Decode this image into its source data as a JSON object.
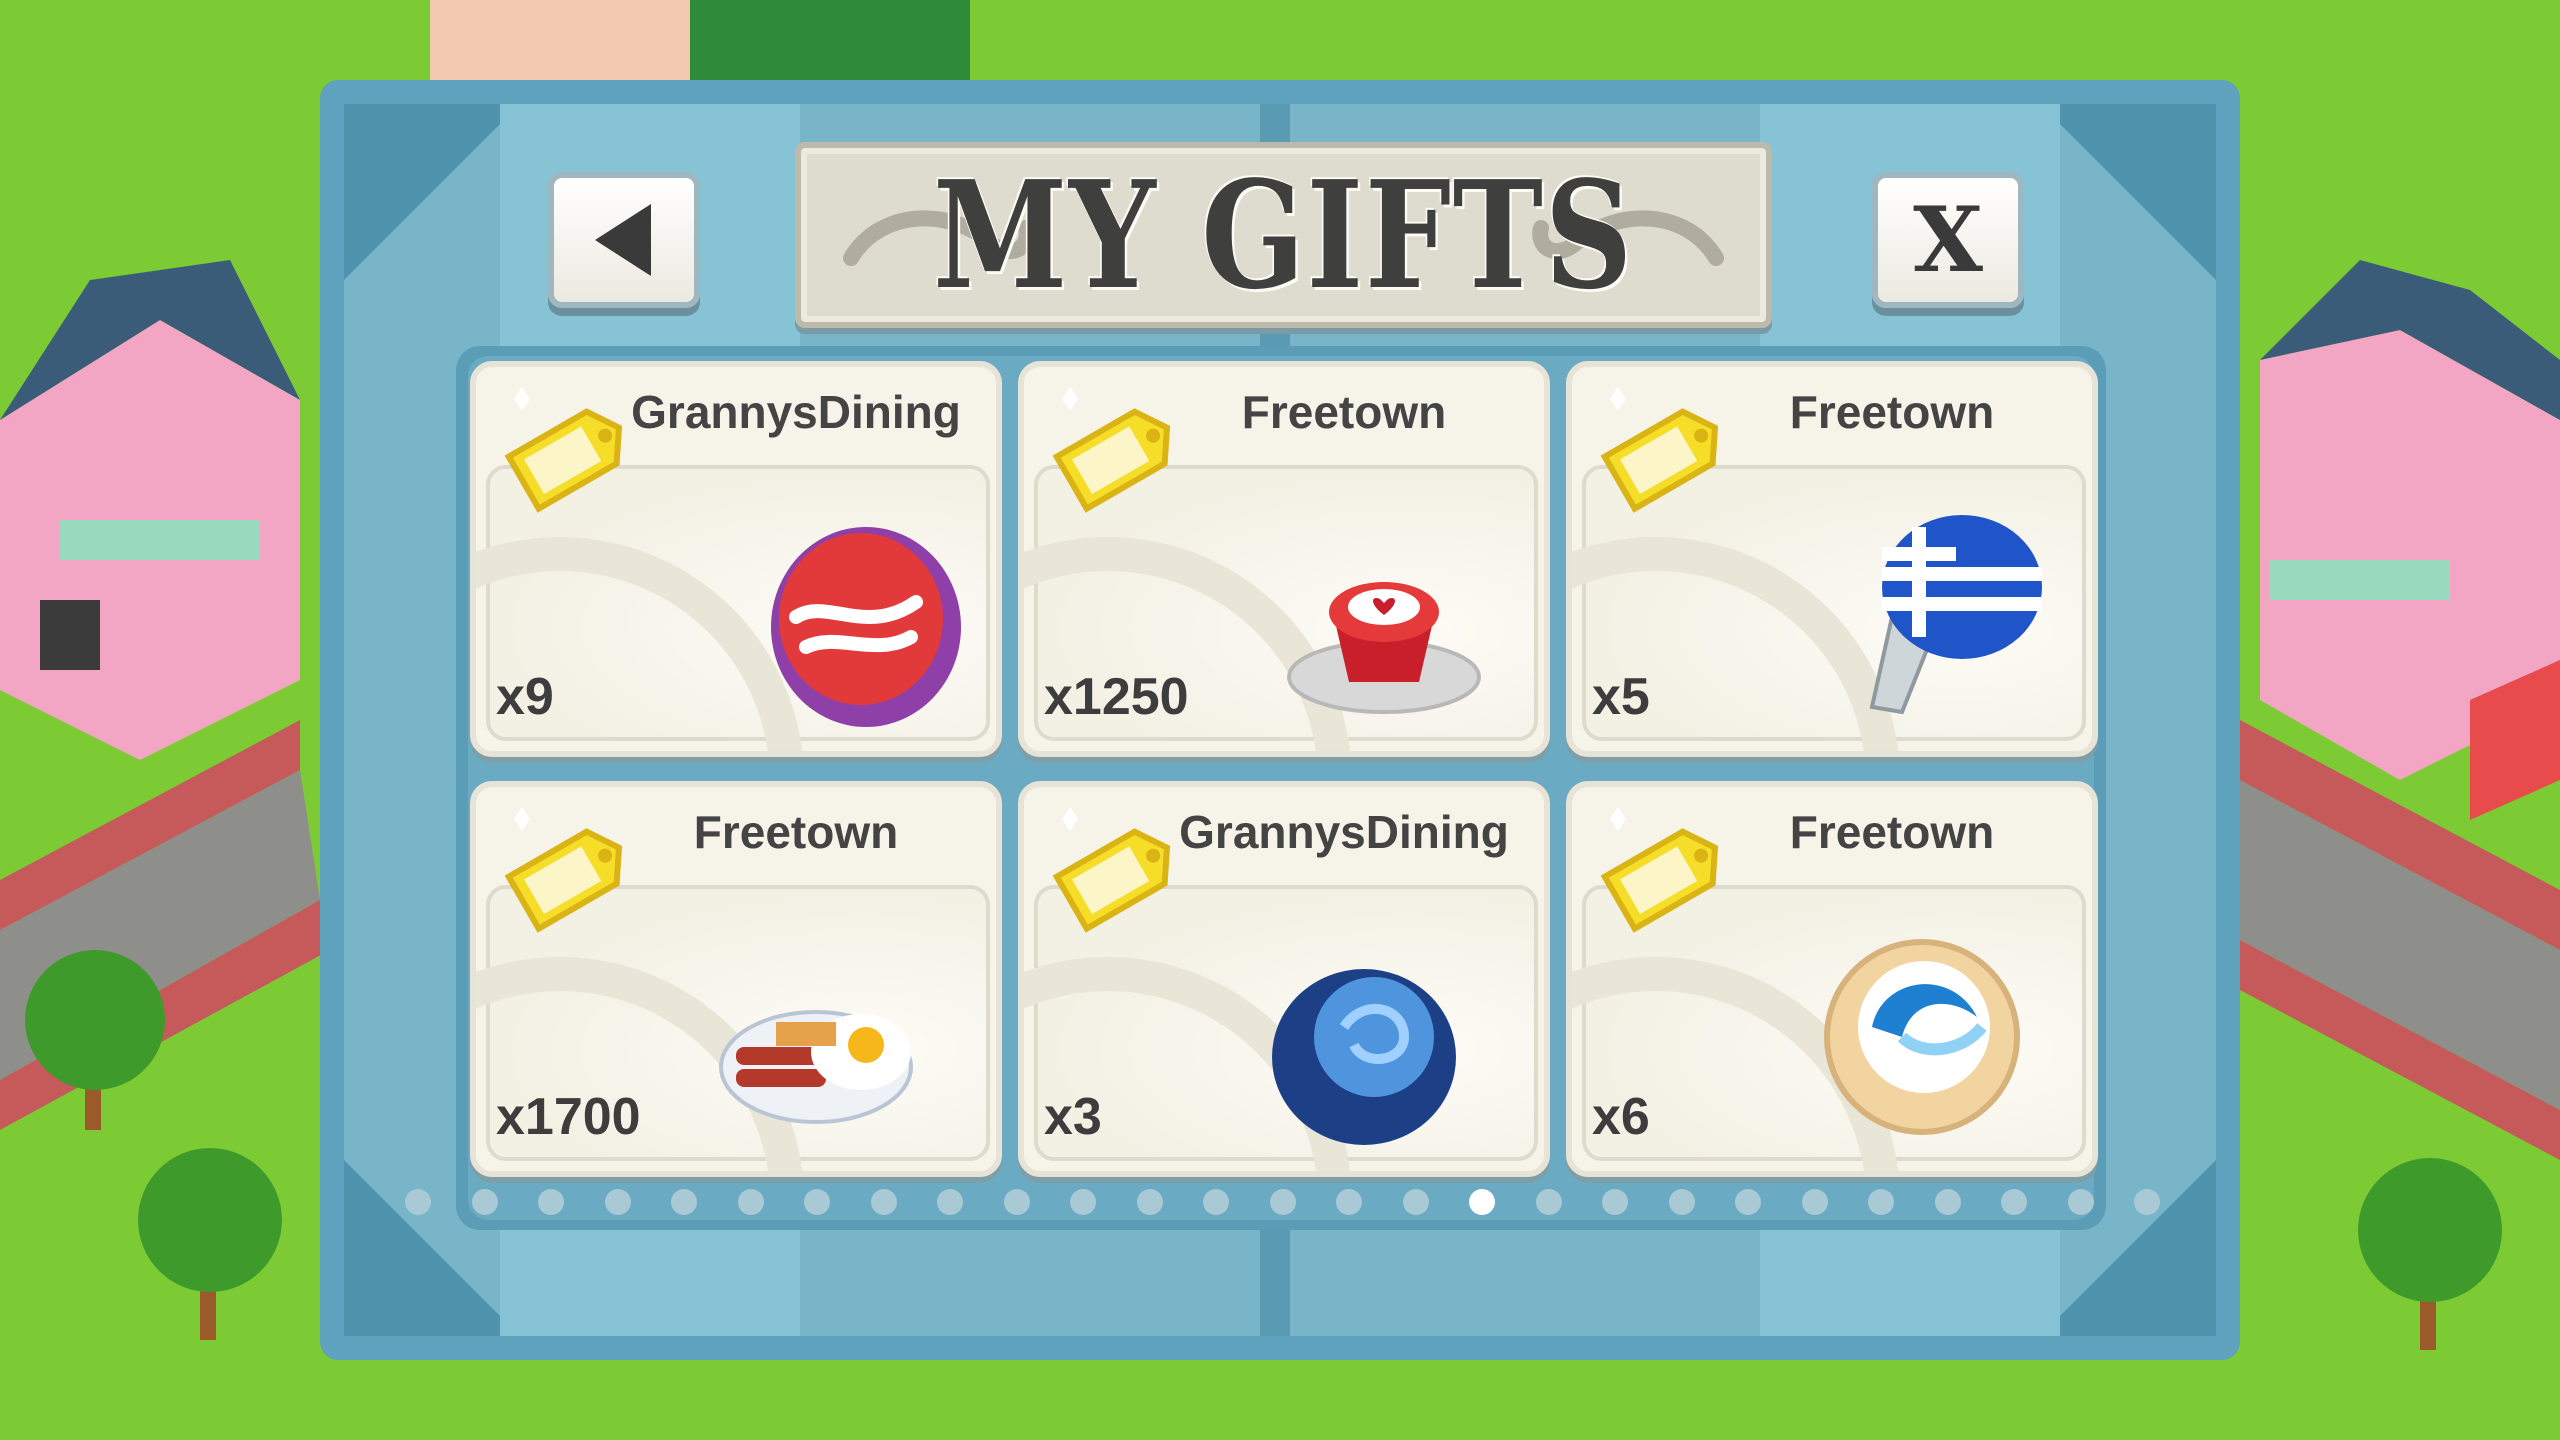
{
  "header": {
    "title": "MY GIFTS",
    "back_icon": "triangle-left-icon",
    "close_label": "X"
  },
  "gifts": [
    {
      "sender": "GrannysDining",
      "quantity": "x9",
      "icon": "red-velvet-cake-icon"
    },
    {
      "sender": "Freetown",
      "quantity": "x1250",
      "icon": "heart-cupcake-icon"
    },
    {
      "sender": "Freetown",
      "quantity": "x5",
      "icon": "greek-flag-faucet-icon"
    },
    {
      "sender": "Freetown",
      "quantity": "x1700",
      "icon": "bacon-eggs-waffle-icon"
    },
    {
      "sender": "GrannysDining",
      "quantity": "x3",
      "icon": "blue-rose-cake-icon"
    },
    {
      "sender": "Freetown",
      "quantity": "x6",
      "icon": "blue-swirl-tart-icon"
    }
  ],
  "pagination": {
    "total_pages": 27,
    "current_page": 17
  },
  "colors": {
    "panel": "#5fa2bd",
    "panel_light": "#8ac7d8",
    "card": "#f6f3e8",
    "grass": "#7ccb35",
    "tag": "#f5dd28"
  }
}
